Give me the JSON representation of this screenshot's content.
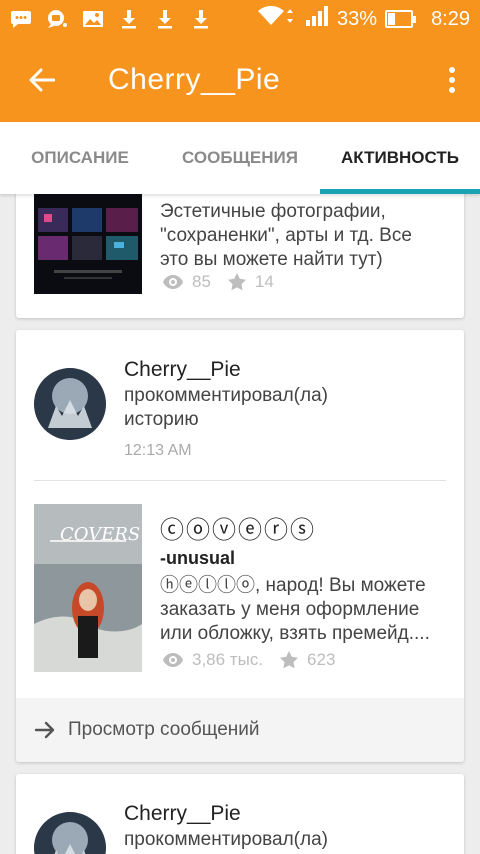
{
  "status_bar": {
    "battery": "33%",
    "battery_level": 0.33,
    "time": "8:29",
    "icons": [
      "chat-icon",
      "message-icon",
      "image-icon",
      "download-icon",
      "download-icon",
      "download-icon",
      "wifi-icon",
      "signal-icon",
      "battery-icon"
    ]
  },
  "app_bar": {
    "title": "Cherry__Pie",
    "back_icon": "arrow-left-icon",
    "menu_icon": "more-vert-icon"
  },
  "tabs": [
    {
      "label": "ОПИСАНИЕ",
      "active": false
    },
    {
      "label": "СООБЩЕНИЯ",
      "active": false
    },
    {
      "label": "АКТИВНОСТЬ",
      "active": true
    }
  ],
  "colors": {
    "primary": "#f7941d",
    "tab_indicator": "#1aa3b5"
  },
  "feed": {
    "partial_post": {
      "text_line1": "Эстетичные фотографии,",
      "text_line2": "\"сохраненки\", арты и тд. Все",
      "text_line3": "это вы можете найти тут)",
      "views": "85",
      "stars": "14"
    },
    "activity1": {
      "user": "Cherry__Pie",
      "action_line1": "прокомментировал(ла)",
      "action_line2": "историю",
      "time": "12:13 AM",
      "story": {
        "title": "ⓒⓞⓥⓔⓡⓢ",
        "author": "-unusual",
        "excerpt_line1": "ⓗⓔⓛⓛⓞ, народ! Вы можете",
        "excerpt_line2": "заказать у меня оформление",
        "excerpt_line3": "или обложку, взять премейд....",
        "views": "3,86 тыс.",
        "stars": "623",
        "cover_text": "COVERS"
      },
      "footer_link": "Просмотр сообщений"
    },
    "activity2": {
      "user": "Cherry__Pie",
      "action_line1": "прокомментировал(ла)"
    }
  }
}
